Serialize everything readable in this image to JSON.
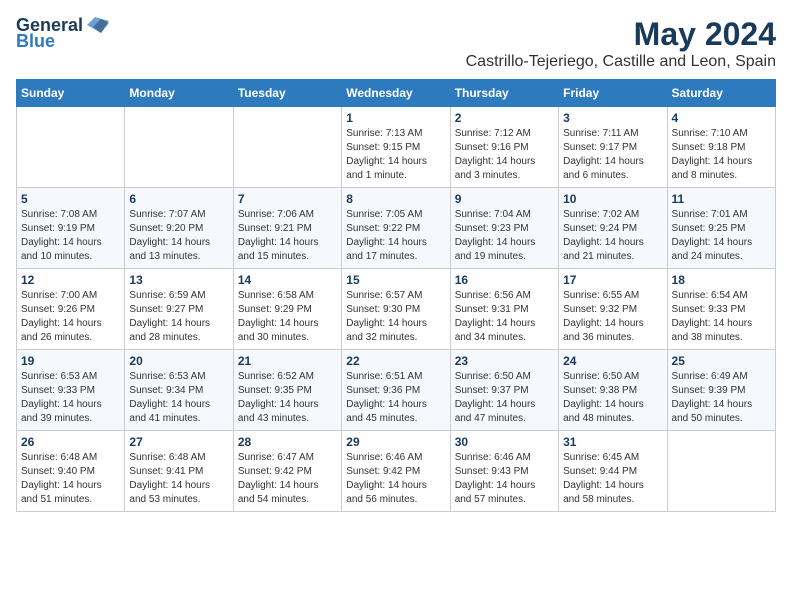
{
  "logo": {
    "general": "General",
    "blue": "Blue"
  },
  "title": "May 2024",
  "subtitle": "Castrillo-Tejeriego, Castille and Leon, Spain",
  "headers": [
    "Sunday",
    "Monday",
    "Tuesday",
    "Wednesday",
    "Thursday",
    "Friday",
    "Saturday"
  ],
  "weeks": [
    [
      {
        "day": "",
        "info": ""
      },
      {
        "day": "",
        "info": ""
      },
      {
        "day": "",
        "info": ""
      },
      {
        "day": "1",
        "info": "Sunrise: 7:13 AM\nSunset: 9:15 PM\nDaylight: 14 hours and 1 minute."
      },
      {
        "day": "2",
        "info": "Sunrise: 7:12 AM\nSunset: 9:16 PM\nDaylight: 14 hours and 3 minutes."
      },
      {
        "day": "3",
        "info": "Sunrise: 7:11 AM\nSunset: 9:17 PM\nDaylight: 14 hours and 6 minutes."
      },
      {
        "day": "4",
        "info": "Sunrise: 7:10 AM\nSunset: 9:18 PM\nDaylight: 14 hours and 8 minutes."
      }
    ],
    [
      {
        "day": "5",
        "info": "Sunrise: 7:08 AM\nSunset: 9:19 PM\nDaylight: 14 hours and 10 minutes."
      },
      {
        "day": "6",
        "info": "Sunrise: 7:07 AM\nSunset: 9:20 PM\nDaylight: 14 hours and 13 minutes."
      },
      {
        "day": "7",
        "info": "Sunrise: 7:06 AM\nSunset: 9:21 PM\nDaylight: 14 hours and 15 minutes."
      },
      {
        "day": "8",
        "info": "Sunrise: 7:05 AM\nSunset: 9:22 PM\nDaylight: 14 hours and 17 minutes."
      },
      {
        "day": "9",
        "info": "Sunrise: 7:04 AM\nSunset: 9:23 PM\nDaylight: 14 hours and 19 minutes."
      },
      {
        "day": "10",
        "info": "Sunrise: 7:02 AM\nSunset: 9:24 PM\nDaylight: 14 hours and 21 minutes."
      },
      {
        "day": "11",
        "info": "Sunrise: 7:01 AM\nSunset: 9:25 PM\nDaylight: 14 hours and 24 minutes."
      }
    ],
    [
      {
        "day": "12",
        "info": "Sunrise: 7:00 AM\nSunset: 9:26 PM\nDaylight: 14 hours and 26 minutes."
      },
      {
        "day": "13",
        "info": "Sunrise: 6:59 AM\nSunset: 9:27 PM\nDaylight: 14 hours and 28 minutes."
      },
      {
        "day": "14",
        "info": "Sunrise: 6:58 AM\nSunset: 9:29 PM\nDaylight: 14 hours and 30 minutes."
      },
      {
        "day": "15",
        "info": "Sunrise: 6:57 AM\nSunset: 9:30 PM\nDaylight: 14 hours and 32 minutes."
      },
      {
        "day": "16",
        "info": "Sunrise: 6:56 AM\nSunset: 9:31 PM\nDaylight: 14 hours and 34 minutes."
      },
      {
        "day": "17",
        "info": "Sunrise: 6:55 AM\nSunset: 9:32 PM\nDaylight: 14 hours and 36 minutes."
      },
      {
        "day": "18",
        "info": "Sunrise: 6:54 AM\nSunset: 9:33 PM\nDaylight: 14 hours and 38 minutes."
      }
    ],
    [
      {
        "day": "19",
        "info": "Sunrise: 6:53 AM\nSunset: 9:33 PM\nDaylight: 14 hours and 39 minutes."
      },
      {
        "day": "20",
        "info": "Sunrise: 6:53 AM\nSunset: 9:34 PM\nDaylight: 14 hours and 41 minutes."
      },
      {
        "day": "21",
        "info": "Sunrise: 6:52 AM\nSunset: 9:35 PM\nDaylight: 14 hours and 43 minutes."
      },
      {
        "day": "22",
        "info": "Sunrise: 6:51 AM\nSunset: 9:36 PM\nDaylight: 14 hours and 45 minutes."
      },
      {
        "day": "23",
        "info": "Sunrise: 6:50 AM\nSunset: 9:37 PM\nDaylight: 14 hours and 47 minutes."
      },
      {
        "day": "24",
        "info": "Sunrise: 6:50 AM\nSunset: 9:38 PM\nDaylight: 14 hours and 48 minutes."
      },
      {
        "day": "25",
        "info": "Sunrise: 6:49 AM\nSunset: 9:39 PM\nDaylight: 14 hours and 50 minutes."
      }
    ],
    [
      {
        "day": "26",
        "info": "Sunrise: 6:48 AM\nSunset: 9:40 PM\nDaylight: 14 hours and 51 minutes."
      },
      {
        "day": "27",
        "info": "Sunrise: 6:48 AM\nSunset: 9:41 PM\nDaylight: 14 hours and 53 minutes."
      },
      {
        "day": "28",
        "info": "Sunrise: 6:47 AM\nSunset: 9:42 PM\nDaylight: 14 hours and 54 minutes."
      },
      {
        "day": "29",
        "info": "Sunrise: 6:46 AM\nSunset: 9:42 PM\nDaylight: 14 hours and 56 minutes."
      },
      {
        "day": "30",
        "info": "Sunrise: 6:46 AM\nSunset: 9:43 PM\nDaylight: 14 hours and 57 minutes."
      },
      {
        "day": "31",
        "info": "Sunrise: 6:45 AM\nSunset: 9:44 PM\nDaylight: 14 hours and 58 minutes."
      },
      {
        "day": "",
        "info": ""
      }
    ]
  ]
}
